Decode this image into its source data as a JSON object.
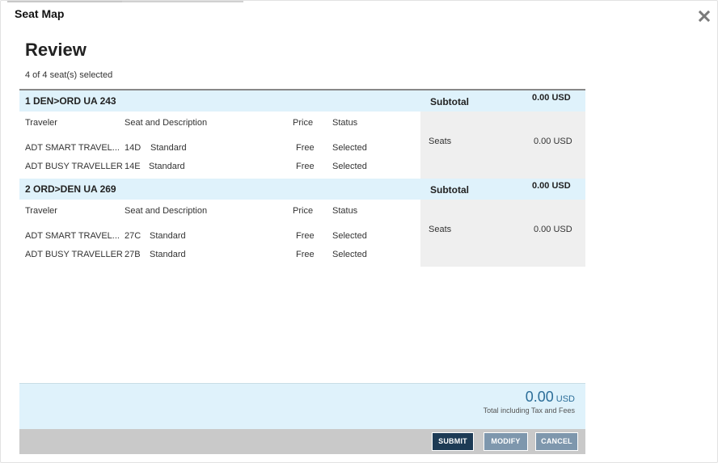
{
  "dialog": {
    "title": "Seat Map"
  },
  "review": {
    "title": "Review",
    "selection_status": "4 of 4 seat(s) selected"
  },
  "columns": {
    "traveler": "Traveler",
    "seat": "Seat and Description",
    "price": "Price",
    "status": "Status"
  },
  "segments": [
    {
      "title": "1 DEN>ORD UA 243",
      "subtotal_label": "Subtotal",
      "subtotal_value": "0.00 USD",
      "seats_label": "Seats",
      "seats_value": "0.00 USD",
      "rows": [
        {
          "traveler": "ADT SMART TRAVEL...",
          "seat": "14D",
          "description": "Standard",
          "price": "Free",
          "status": "Selected"
        },
        {
          "traveler": "ADT BUSY TRAVELLER",
          "seat": "14E",
          "description": "Standard",
          "price": "Free",
          "status": "Selected"
        }
      ]
    },
    {
      "title": "2 ORD>DEN UA 269",
      "subtotal_label": "Subtotal",
      "subtotal_value": "0.00 USD",
      "seats_label": "Seats",
      "seats_value": "0.00 USD",
      "rows": [
        {
          "traveler": "ADT SMART TRAVEL...",
          "seat": "27C",
          "description": "Standard",
          "price": "Free",
          "status": "Selected"
        },
        {
          "traveler": "ADT BUSY TRAVELLER",
          "seat": "27B",
          "description": "Standard",
          "price": "Free",
          "status": "Selected"
        }
      ]
    }
  ],
  "total": {
    "amount": "0.00",
    "currency": "USD",
    "caption": "Total including Tax and Fees"
  },
  "actions": {
    "submit": "SUBMIT",
    "modify": "MODIFY",
    "cancel": "CANCEL"
  },
  "colors": {
    "accent": "#2c6e99",
    "band": "#dff2fb",
    "submit": "#1d3b55",
    "secondary": "#7e97ad"
  },
  "icons": {
    "close": "close-icon"
  }
}
